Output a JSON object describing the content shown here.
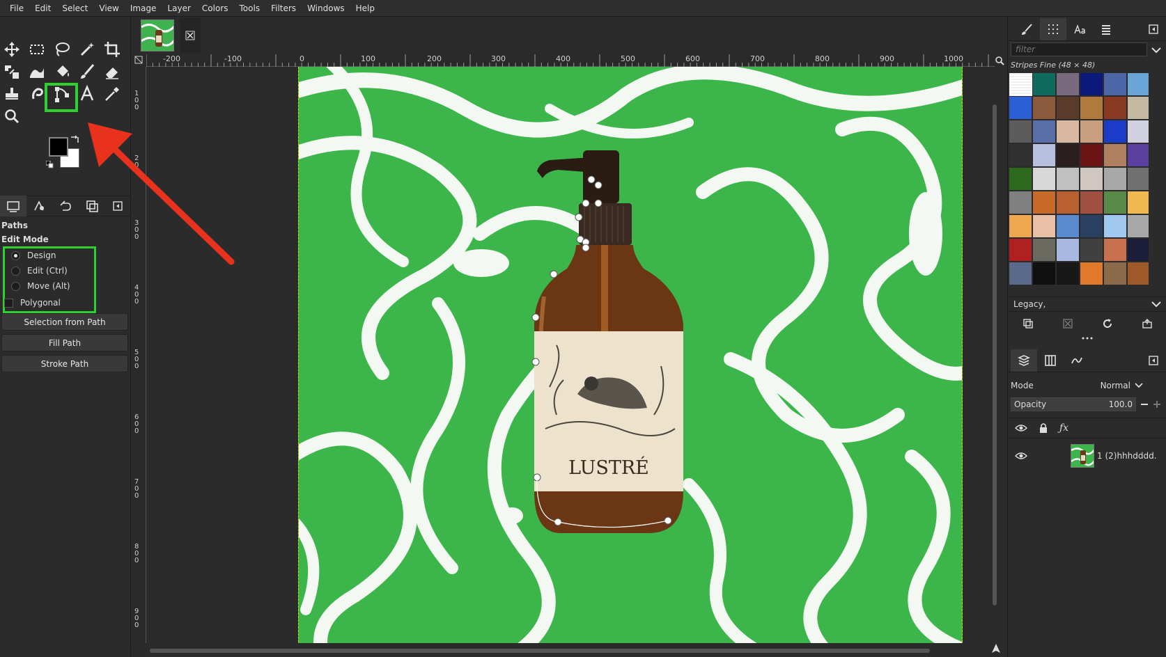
{
  "menu": [
    "File",
    "Edit",
    "Select",
    "View",
    "Image",
    "Layer",
    "Colors",
    "Tools",
    "Filters",
    "Windows",
    "Help"
  ],
  "tool_options": {
    "title": "Paths",
    "edit_mode_label": "Edit Mode",
    "modes": [
      "Design",
      "Edit (Ctrl)",
      "Move (Alt)"
    ],
    "selected_mode": "Design",
    "polygonal_label": "Polygonal",
    "buttons": [
      "Selection from Path",
      "Fill Path",
      "Stroke Path"
    ]
  },
  "ruler": {
    "h_labels": [
      "-200",
      "-100",
      "0",
      "100",
      "200",
      "300",
      "400",
      "500",
      "600",
      "700",
      "800",
      "900",
      "1000"
    ],
    "v_labels": [
      "100",
      "200",
      "300",
      "400",
      "500",
      "600",
      "700",
      "800",
      "900"
    ]
  },
  "canvas": {
    "product_label": "LUSTRÉ"
  },
  "patterns": {
    "filter_placeholder": "filter",
    "selected_title": "Stripes Fine (48 × 48)",
    "tag_filter": "Legacy,",
    "swatch_colors": [
      "#ffffff",
      "#0f6b5e",
      "#7a6a7e",
      "#0b1a7a",
      "#4d66a8",
      "#6aa5d8",
      "#2a5fd6",
      "#8b5a3c",
      "#5a3b2a",
      "#b07a3c",
      "#8a3a22",
      "#c4b8a0",
      "#5c5c5c",
      "#5a6fa8",
      "#d8b8a0",
      "#c8a080",
      "#1a3cc8",
      "#d0d0e0",
      "#303030",
      "#b8c0e0",
      "#2a1e1e",
      "#6a1414",
      "#b08060",
      "#5a3ea0",
      "#2e6a1e",
      "#d8d8d8",
      "#c0c0c0",
      "#d0c8c0",
      "#a8a8a8",
      "#707070",
      "#808080",
      "#c86a2a",
      "#b86030",
      "#a05040",
      "#5a8a4a",
      "#f0b850",
      "#f0a850",
      "#e8c0a8",
      "#5a8ad0",
      "#2a4060",
      "#a0c8f0",
      "#a8a8a8",
      "#b02020",
      "#6a6a60",
      "#a8b8e0",
      "#404040",
      "#c87050",
      "#1a1e3a",
      "#5a6a8a",
      "#101010",
      "#181818",
      "#e07a2a",
      "#8a6a4a",
      "#a05a2a"
    ]
  },
  "layers": {
    "mode_label": "Mode",
    "mode_value": "Normal",
    "opacity_label": "Opacity",
    "opacity_value": "100.0",
    "layer_name": "1 (2)hhhdddd."
  },
  "colors": {
    "highlight": "#2fd02f",
    "arrow": "#e8321e",
    "canvas_green": "#3cb64b"
  }
}
